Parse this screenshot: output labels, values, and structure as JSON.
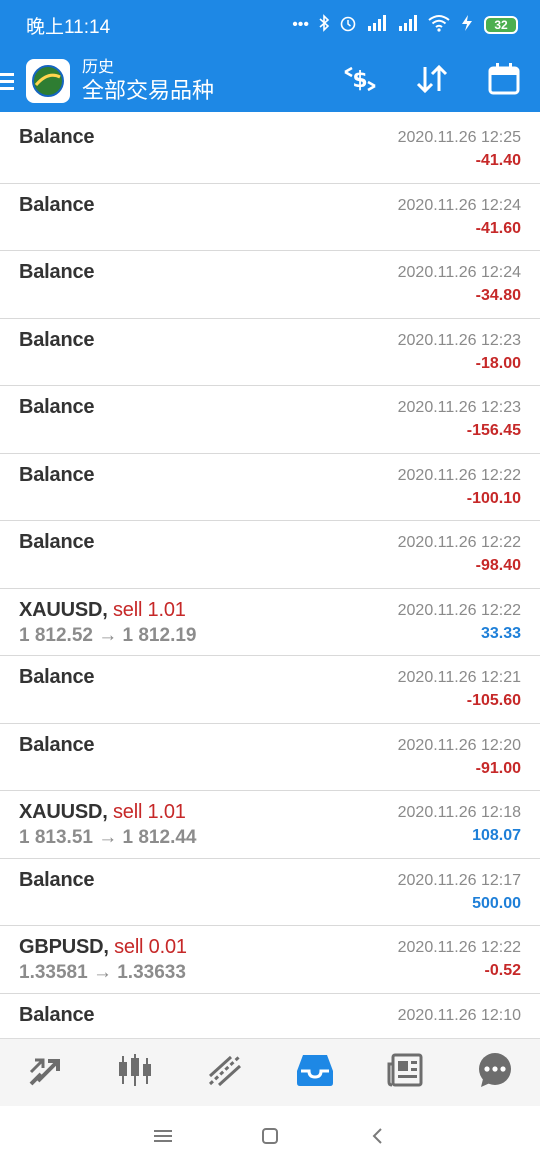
{
  "status_bar": {
    "time": "晚上11:14",
    "battery": "32"
  },
  "toolbar": {
    "subtitle": "历史",
    "title": "全部交易品种"
  },
  "rows": [
    {
      "title": "Balance",
      "time": "2020.11.26 12:25",
      "amount": "-41.40",
      "sign": "neg"
    },
    {
      "title": "Balance",
      "time": "2020.11.26 12:24",
      "amount": "-41.60",
      "sign": "neg"
    },
    {
      "title": "Balance",
      "time": "2020.11.26 12:24",
      "amount": "-34.80",
      "sign": "neg"
    },
    {
      "title": "Balance",
      "time": "2020.11.26 12:23",
      "amount": "-18.00",
      "sign": "neg"
    },
    {
      "title": "Balance",
      "time": "2020.11.26 12:23",
      "amount": "-156.45",
      "sign": "neg"
    },
    {
      "title": "Balance",
      "time": "2020.11.26 12:22",
      "amount": "-100.10",
      "sign": "neg"
    },
    {
      "title": "Balance",
      "time": "2020.11.26 12:22",
      "amount": "-98.40",
      "sign": "neg"
    },
    {
      "symbol": "XAUUSD,",
      "side": "sell 1.01",
      "prices": "1 812.52 → 1 812.19",
      "time": "2020.11.26 12:22",
      "amount": "33.33",
      "sign": "pos"
    },
    {
      "title": "Balance",
      "time": "2020.11.26 12:21",
      "amount": "-105.60",
      "sign": "neg"
    },
    {
      "title": "Balance",
      "time": "2020.11.26 12:20",
      "amount": "-91.00",
      "sign": "neg"
    },
    {
      "symbol": "XAUUSD,",
      "side": "sell 1.01",
      "prices": "1 813.51 → 1 812.44",
      "time": "2020.11.26 12:18",
      "amount": "108.07",
      "sign": "pos"
    },
    {
      "title": "Balance",
      "time": "2020.11.26 12:17",
      "amount": "500.00",
      "sign": "pos"
    },
    {
      "symbol": "GBPUSD,",
      "side": "sell 0.01",
      "prices": "1.33581 → 1.33633",
      "time": "2020.11.26 12:22",
      "amount": "-0.52",
      "sign": "neg"
    },
    {
      "title": "Balance",
      "time": "2020.11.26 12:10",
      "amount": "",
      "sign": "neg"
    }
  ],
  "colors": {
    "primary": "#1e88e5",
    "negative": "#c62828",
    "positive": "#1e7fd8"
  },
  "icons": {
    "toolbar": [
      "currency-exchange-icon",
      "sort-icon",
      "calendar-icon"
    ],
    "bottom_nav": [
      "quotes-icon",
      "chart-icon",
      "trade-icon",
      "history-icon",
      "news-icon",
      "chat-icon"
    ]
  }
}
